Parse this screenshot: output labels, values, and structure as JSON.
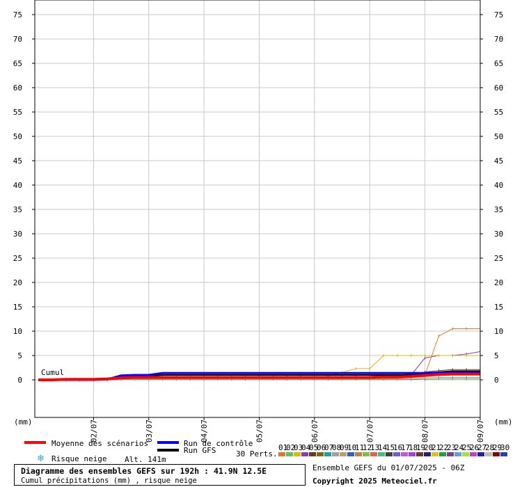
{
  "chart_data": {
    "type": "line",
    "title": "Diagramme des ensembles GEFS sur 192h : 41.9N 12.5E",
    "subtitle": "Cumul précipitations (mm) , risque neige",
    "ylabel_left": "(mm)",
    "ylabel_right": "(mm)",
    "ylim": [
      0,
      75
    ],
    "y_ticks": [
      0,
      5,
      10,
      15,
      20,
      25,
      30,
      35,
      40,
      45,
      50,
      55,
      60,
      65,
      70,
      75
    ],
    "x_tick_labels": [
      "02/07",
      "03/07",
      "04/07",
      "05/07",
      "06/07",
      "07/07",
      "08/07",
      "09/07"
    ],
    "series_label": "Cumul",
    "grid": true,
    "x_hours": [
      6,
      12,
      18,
      24,
      30,
      36,
      42,
      48,
      54,
      60,
      66,
      72,
      78,
      84,
      90,
      96,
      102,
      108,
      114,
      120,
      126,
      132,
      138,
      144,
      150,
      156,
      162,
      168,
      174,
      180,
      186,
      192
    ],
    "series": [
      {
        "name": "Moyenne des scénarios",
        "color": "#ff0000",
        "width": 4,
        "values": [
          0,
          0.1,
          0.1,
          0.1,
          0.2,
          0.4,
          0.5,
          0.5,
          0.5,
          0.5,
          0.5,
          0.5,
          0.5,
          0.5,
          0.5,
          0.5,
          0.5,
          0.5,
          0.5,
          0.5,
          0.5,
          0.5,
          0.5,
          0.5,
          0.6,
          0.6,
          0.7,
          0.9,
          1.1,
          1.2,
          1.2,
          1.2
        ]
      },
      {
        "name": "Run de contrôle",
        "color": "#0000ff",
        "width": 3,
        "values": [
          0,
          0,
          0,
          0,
          0.1,
          0.9,
          1.0,
          1.0,
          1.4,
          1.4,
          1.4,
          1.4,
          1.4,
          1.4,
          1.4,
          1.4,
          1.4,
          1.4,
          1.4,
          1.4,
          1.4,
          1.4,
          1.4,
          1.4,
          1.4,
          1.4,
          1.4,
          1.4,
          1.5,
          1.5,
          1.5,
          1.5
        ]
      },
      {
        "name": "Run GFS",
        "color": "#000000",
        "width": 2,
        "values": [
          0,
          0,
          0,
          0,
          0.1,
          0.5,
          0.8,
          0.8,
          1.0,
          1.0,
          1.0,
          1.0,
          1.0,
          1.0,
          1.0,
          1.0,
          1.0,
          1.0,
          1.0,
          1.0,
          1.0,
          1.0,
          1.0,
          1.0,
          1.0,
          1.0,
          1.0,
          1.2,
          1.6,
          1.8,
          1.8,
          1.8
        ]
      },
      {
        "name": "perturbation orange",
        "color": "#e07a28",
        "width": 1,
        "values": [
          0,
          0,
          0,
          0,
          0,
          0.3,
          0.3,
          0.3,
          0.3,
          0.3,
          0.3,
          0.3,
          0.3,
          0.3,
          0.3,
          0.3,
          0.3,
          0.3,
          0.3,
          0.3,
          0.3,
          0.3,
          0.3,
          0.3,
          0.3,
          0.3,
          0.5,
          1.0,
          9.0,
          10.5,
          10.5,
          10.5
        ]
      },
      {
        "name": "perturbation jaune",
        "color": "#e8b400",
        "width": 1,
        "values": [
          0,
          0,
          0,
          0,
          0,
          0.3,
          0.3,
          0.3,
          0.5,
          0.5,
          0.5,
          0.5,
          0.5,
          0.5,
          0.5,
          0.5,
          0.5,
          0.5,
          0.5,
          0.5,
          0.8,
          1.5,
          2.3,
          2.3,
          5.0,
          5.0,
          5.0,
          5.0,
          5.0,
          5.0,
          5.0,
          5.0
        ]
      },
      {
        "name": "perturbation violette",
        "color": "#8040c0",
        "width": 1,
        "values": [
          0,
          0,
          0,
          0,
          0,
          0.3,
          0.3,
          0.3,
          0.3,
          0.3,
          0.3,
          0.3,
          0.3,
          0.3,
          0.3,
          0.3,
          0.3,
          0.3,
          0.3,
          0.3,
          0.3,
          0.3,
          0.3,
          0.3,
          0.3,
          0.5,
          1.0,
          4.5,
          5.0,
          5.0,
          5.3,
          5.8
        ]
      },
      {
        "name": "perturbation marron",
        "color": "#6a3a20",
        "width": 1,
        "values": [
          0,
          0,
          0,
          0,
          0,
          0.5,
          0.7,
          0.7,
          0.7,
          0.7,
          0.7,
          0.7,
          0.7,
          0.7,
          0.7,
          0.7,
          0.7,
          0.7,
          0.7,
          0.7,
          0.7,
          0.7,
          0.7,
          0.7,
          0.9,
          1.0,
          1.2,
          1.6,
          1.9,
          2.1,
          2.1,
          2.1
        ]
      },
      {
        "name": "perturbation grise",
        "color": "#909090",
        "width": 1,
        "values": [
          0,
          0,
          0,
          0,
          0,
          0.2,
          0.2,
          0.2,
          0.2,
          0.2,
          0.2,
          0.2,
          0.2,
          0.2,
          0.2,
          0.2,
          0.2,
          0.2,
          0.2,
          0.2,
          0.2,
          0.2,
          0.2,
          0.2,
          0.2,
          0.2,
          0.2,
          0.4,
          0.5,
          0.5,
          0.5,
          0.5
        ]
      },
      {
        "name": "perturbation verte",
        "color": "#5a9a30",
        "width": 1,
        "values": [
          0,
          0,
          0,
          0,
          0,
          0.1,
          0.1,
          0.1,
          0.1,
          0.1,
          0.1,
          0.1,
          0.1,
          0.1,
          0.1,
          0.1,
          0.1,
          0.1,
          0.1,
          0.1,
          0.1,
          0.1,
          0.1,
          0.1,
          0.1,
          0.1,
          0.1,
          0.1,
          0.2,
          0.2,
          0.2,
          0.2
        ]
      }
    ]
  },
  "legend": {
    "mean_label": "Moyenne des scénarios",
    "control_label": "Run de contrôle",
    "gfs_label": "Run GFS",
    "snow_label": "Risque neige",
    "altitude": "Alt. 141m",
    "perts_label": "30 Perts.",
    "mean_color": "#ff0000",
    "control_color": "#0000ff",
    "gfs_color": "#000000",
    "snow_color": "#3aa0e0",
    "pert_numbers": [
      "01",
      "02",
      "03",
      "04",
      "05",
      "06",
      "07",
      "08",
      "09",
      "10",
      "11",
      "12",
      "13",
      "14",
      "15",
      "16",
      "17",
      "18",
      "19",
      "20",
      "21",
      "22",
      "23",
      "24",
      "25",
      "26",
      "27",
      "28",
      "29",
      "30"
    ],
    "pert_colors": [
      "#e07a28",
      "#60c060",
      "#e8b400",
      "#8040c0",
      "#6a3a20",
      "#7a6a10",
      "#20a0a0",
      "#a0a0a0",
      "#c0a060",
      "#3060c0",
      "#c08040",
      "#80c040",
      "#e06060",
      "#40c080",
      "#404040",
      "#6060e0",
      "#c060c0",
      "#a040e0",
      "#604020",
      "#202080",
      "#e0c020",
      "#20a040",
      "#804080",
      "#60a0e0",
      "#a0e040",
      "#c040c0",
      "#2020a0",
      "#c0c0a0",
      "#800000",
      "#2040c0"
    ]
  },
  "footer": {
    "title": "Diagramme des ensembles GEFS sur 192h : 41.9N 12.5E",
    "subtitle": "Cumul précipitations (mm) , risque neige",
    "run": "Ensemble GEFS du 01/07/2025 - 06Z",
    "copyright": "Copyright 2025 Meteociel.fr"
  }
}
